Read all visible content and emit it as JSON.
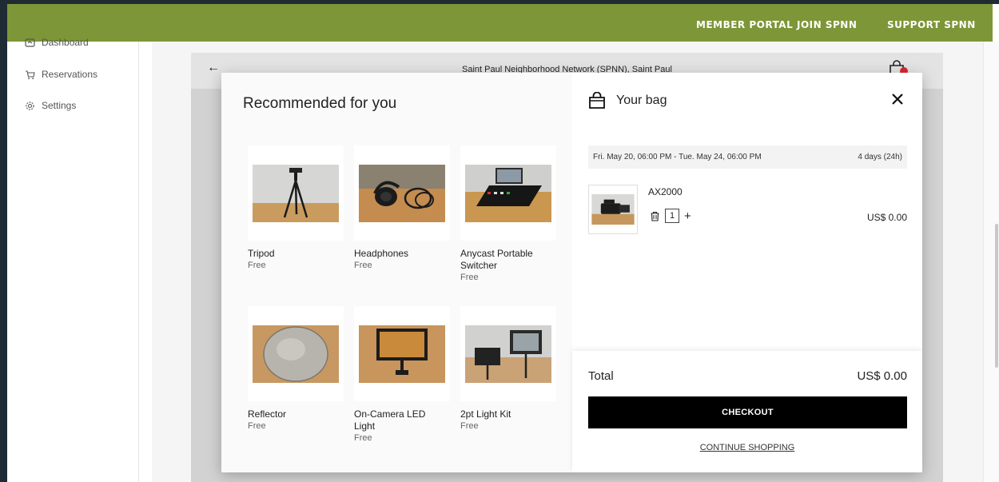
{
  "nav": {
    "member_portal": "MEMBER PORTAL",
    "join": "JOIN SPNN",
    "support": "SUPPORT SPNN"
  },
  "sidebar": {
    "items": [
      {
        "label": "Dashboard",
        "icon": "dashboard-icon"
      },
      {
        "label": "Reservations",
        "icon": "cart-icon"
      },
      {
        "label": "Settings",
        "icon": "gear-icon"
      }
    ]
  },
  "store": {
    "title": "Saint Paul Neighborhood Network (SPNN), Saint Paul"
  },
  "recommendations": {
    "title": "Recommended for you",
    "products": [
      {
        "name": "Tripod",
        "price": "Free"
      },
      {
        "name": "Headphones",
        "price": "Free"
      },
      {
        "name": "Anycast Portable Switcher",
        "price": "Free"
      },
      {
        "name": "Reflector",
        "price": "Free"
      },
      {
        "name": "On-Camera LED Light",
        "price": "Free"
      },
      {
        "name": "2pt Light Kit",
        "price": "Free"
      }
    ]
  },
  "bag": {
    "title": "Your bag",
    "dates": "Fri. May 20, 06:00 PM - Tue. May 24, 06:00 PM",
    "duration": "4 days (24h)",
    "item": {
      "name": "AX2000",
      "quantity": "1",
      "price": "US$ 0.00"
    },
    "total_label": "Total",
    "total_value": "US$ 0.00",
    "checkout_label": "CHECKOUT",
    "continue_label": "CONTINUE SHOPPING"
  },
  "colors": {
    "brand_green": "#7d9637",
    "frame": "#1f2b34",
    "checkout_bg": "#000000",
    "badge_red": "#d9282f"
  }
}
